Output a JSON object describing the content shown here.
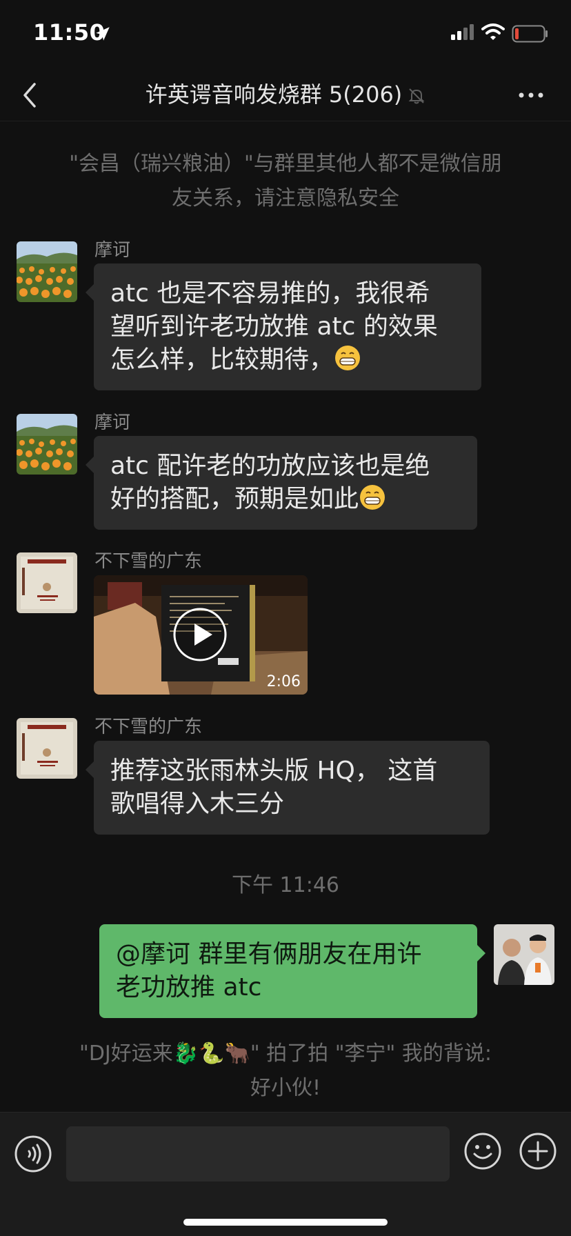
{
  "status_bar": {
    "time": "11:50"
  },
  "nav": {
    "title": "许英谔音响发烧群 5(206)"
  },
  "notices": {
    "privacy_line1": "\"会昌（瑞兴粮油）\"与群里其他人都不是微信朋",
    "privacy_line2": "友关系，请注意隐私安全",
    "pat_line1": "\"DJ好运来🐉🐍🐂\" 拍了拍 \"李宁\" 我的背说:",
    "pat_line2": "好小伙!"
  },
  "messages": [
    {
      "sender": "摩诃",
      "lines": [
        "atc 也是不容易推的，我很希",
        "望听到许老功放推 atc 的效果",
        "怎么样，比较期待，"
      ]
    },
    {
      "sender": "摩诃",
      "lines": [
        "atc 配许老的功放应该也是绝",
        "好的搭配，预期是如此"
      ]
    },
    {
      "sender": "不下雪的广东",
      "video_duration": "2:06"
    },
    {
      "sender": "不下雪的广东",
      "lines": [
        "推荐这张雨林头版 HQ， 这首",
        "歌唱得入木三分"
      ]
    }
  ],
  "timestamp": "下午 11:46",
  "my_message": {
    "lines": [
      "@摩诃 群里有俩朋友在用许",
      "老功放推 atc"
    ]
  },
  "input": {
    "value": ""
  },
  "colors": {
    "background": "#111111",
    "bubble": "#2c2c2c",
    "my_bubble": "#5fb86a",
    "battery_low": "#e14a3b"
  },
  "icons": [
    "location-arrow-icon",
    "signal-icon",
    "wifi-icon",
    "battery-icon",
    "back-icon",
    "mute-bell-icon",
    "more-icon",
    "grin-emoji-icon",
    "play-icon",
    "voice-icon",
    "emoji-icon",
    "plus-icon"
  ]
}
